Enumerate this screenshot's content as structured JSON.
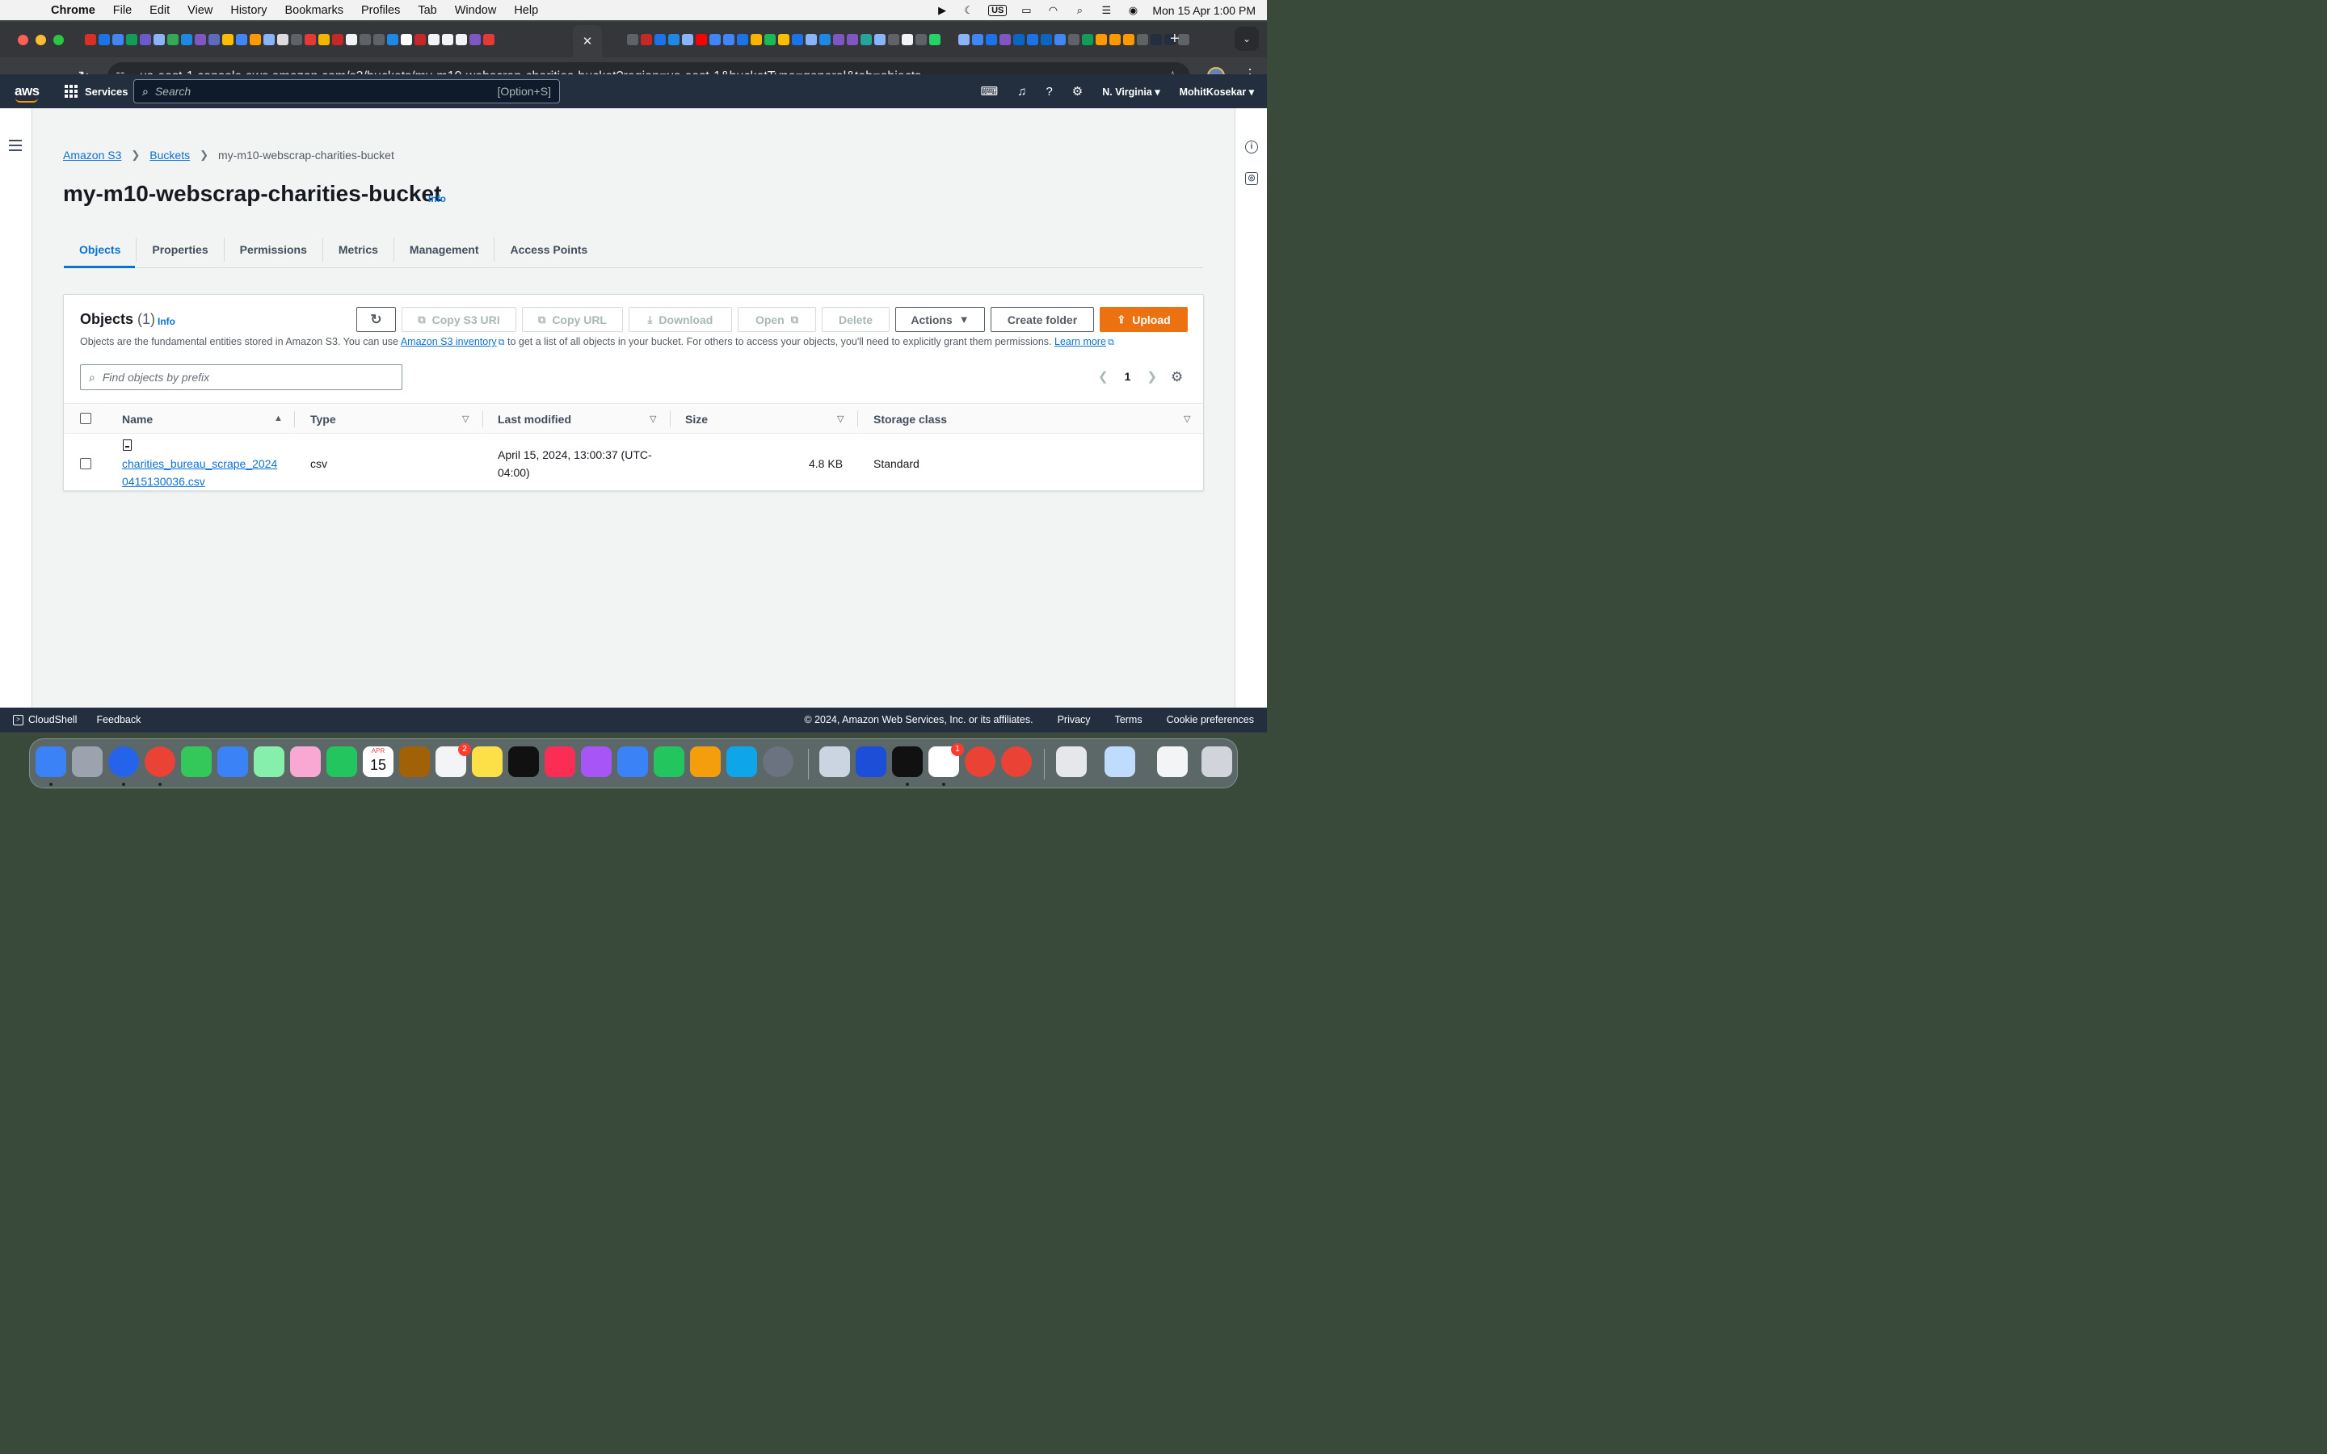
{
  "menubar": {
    "app": "Chrome",
    "items": [
      "File",
      "Edit",
      "View",
      "History",
      "Bookmarks",
      "Profiles",
      "Tab",
      "Window",
      "Help"
    ],
    "keyboard": "US",
    "clock": "Mon 15 Apr  1:00 PM"
  },
  "browser": {
    "url": "us-east-1.console.aws.amazon.com/s3/buckets/my-m10-webscrap-charities-bucket?region=us-east-1&bucketType=general&tab=objects"
  },
  "aws_nav": {
    "logo": "aws",
    "services": "Services",
    "search_placeholder": "Search",
    "search_shortcut": "[Option+S]",
    "region": "N. Virginia",
    "user": "MohitKosekar"
  },
  "breadcrumb": {
    "root": "Amazon S3",
    "buckets": "Buckets",
    "current": "my-m10-webscrap-charities-bucket"
  },
  "page": {
    "title": "my-m10-webscrap-charities-bucket",
    "info": "Info"
  },
  "tabs": [
    "Objects",
    "Properties",
    "Permissions",
    "Metrics",
    "Management",
    "Access Points"
  ],
  "objects_panel": {
    "title": "Objects",
    "count": "(1)",
    "info": "Info",
    "desc_before": "Objects are the fundamental entities stored in Amazon S3. You can use",
    "inventory_link": "Amazon S3 inventory",
    "desc_after": "to get a list of all objects in your bucket. For others to access your objects, you'll need to explicitly grant them permissions.",
    "learn_more": "Learn more",
    "buttons": {
      "copy_s3_uri": "Copy S3 URI",
      "copy_url": "Copy URL",
      "download": "Download",
      "open": "Open",
      "delete": "Delete",
      "actions": "Actions",
      "create_folder": "Create folder",
      "upload": "Upload"
    },
    "filter_placeholder": "Find objects by prefix",
    "page": "1",
    "columns": [
      "Name",
      "Type",
      "Last modified",
      "Size",
      "Storage class"
    ],
    "rows": [
      {
        "name_line1": "charities_bureau_scrape_2024",
        "name_line2": "0415130036.csv",
        "type": "csv",
        "modified_line1": "April 15, 2024, 13:00:37 (UTC-",
        "modified_line2": "04:00)",
        "size": "4.8 KB",
        "storage_class": "Standard"
      }
    ]
  },
  "footer": {
    "cloudshell": "CloudShell",
    "feedback": "Feedback",
    "copyright": "© 2024, Amazon Web Services, Inc. or its affiliates.",
    "privacy": "Privacy",
    "terms": "Terms",
    "cookies": "Cookie preferences"
  },
  "dock": {
    "calendar_month": "APR",
    "calendar_day": "15",
    "reminders_badge": "2",
    "slack_badge": "1"
  },
  "colors": {
    "aws_nav": "#232f3e",
    "link": "#0972d3",
    "upload": "#ec7211"
  }
}
